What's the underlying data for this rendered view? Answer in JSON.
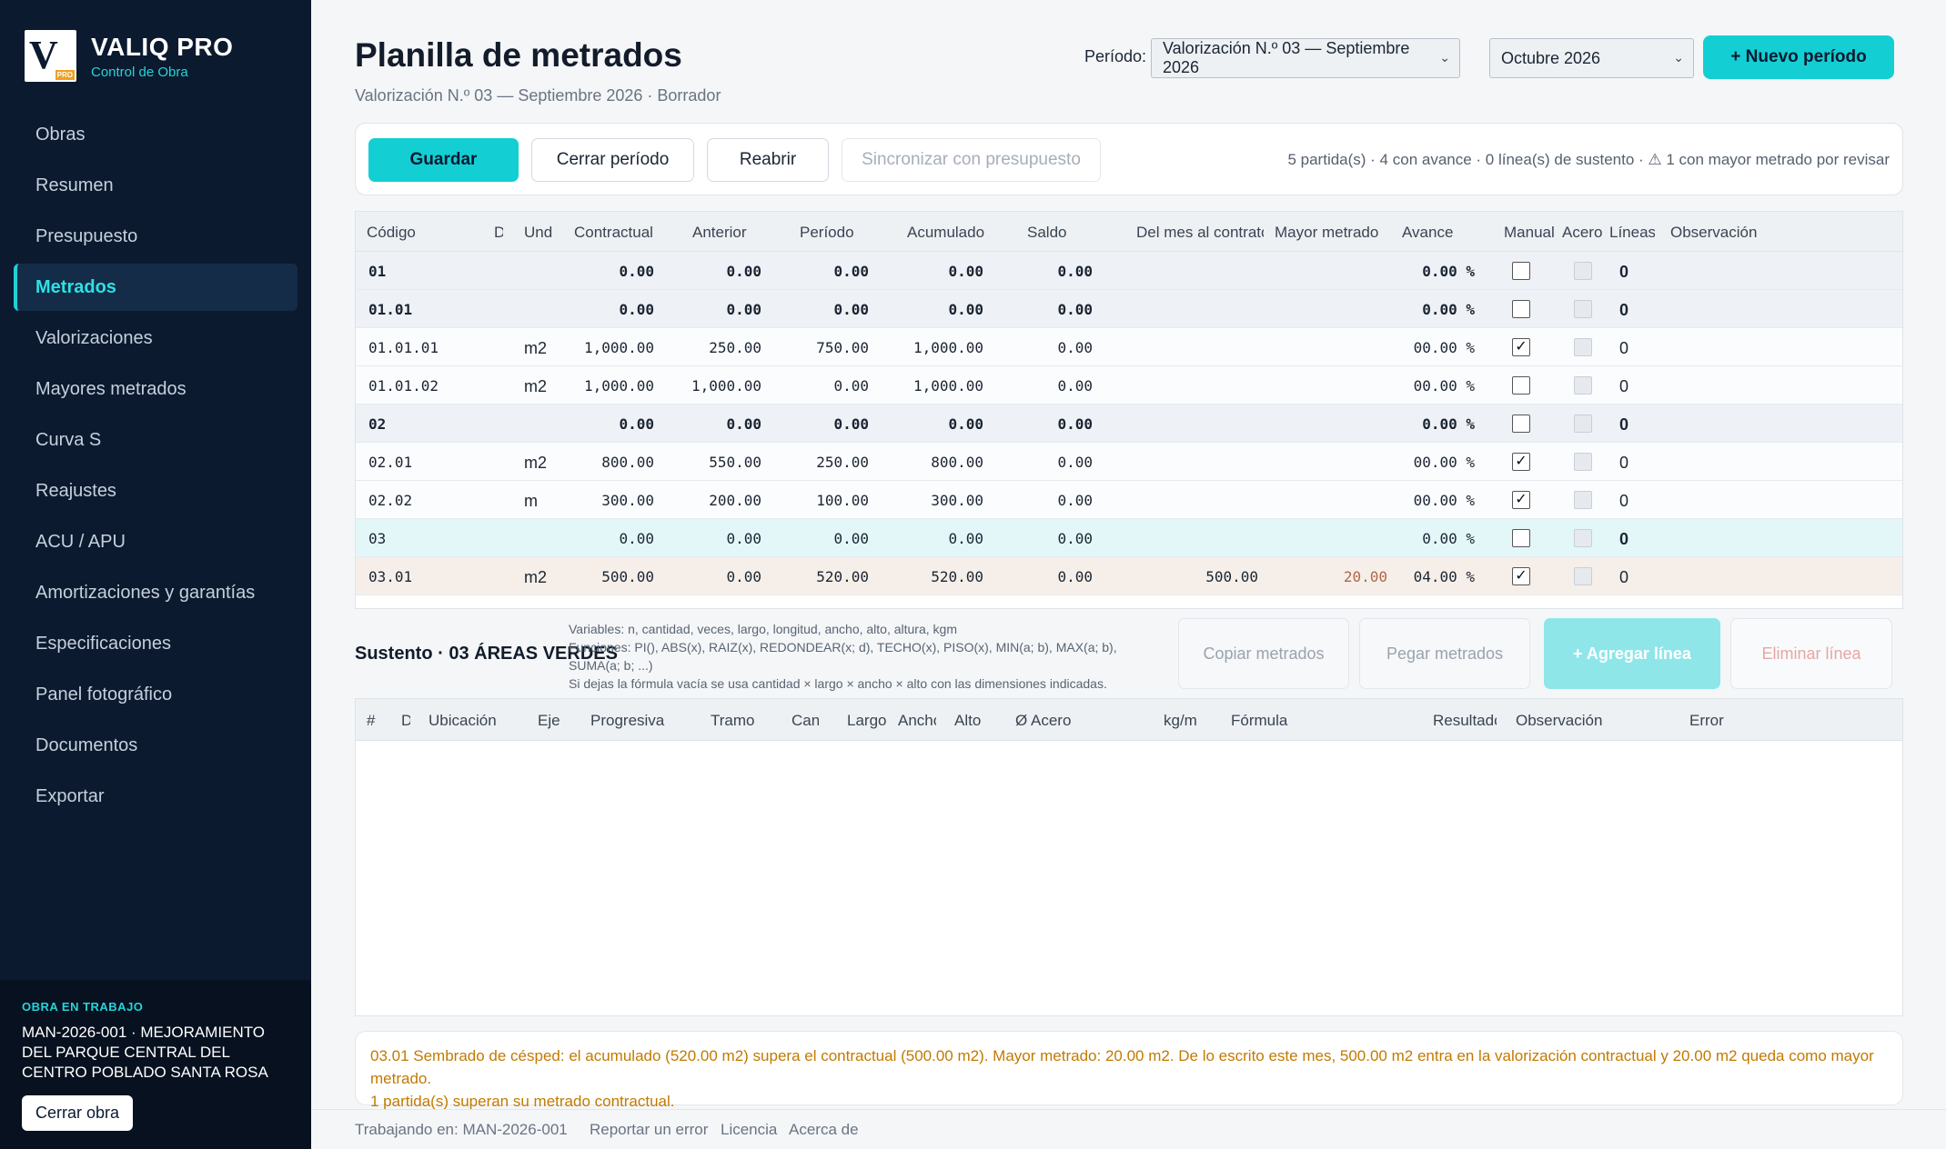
{
  "sidebar": {
    "brand_title": "VALIQ PRO",
    "brand_sub": "Control de Obra",
    "logo_letter": "V",
    "logo_badge": "PRO",
    "items": [
      {
        "label": "Obras"
      },
      {
        "label": "Resumen"
      },
      {
        "label": "Presupuesto"
      },
      {
        "label": "Metrados",
        "active": true
      },
      {
        "label": "Valorizaciones"
      },
      {
        "label": "Mayores metrados"
      },
      {
        "label": "Curva S"
      },
      {
        "label": "Reajustes"
      },
      {
        "label": "ACU / APU"
      },
      {
        "label": "Amortizaciones y garantías"
      },
      {
        "label": "Especificaciones"
      },
      {
        "label": "Panel fotográfico"
      },
      {
        "label": "Documentos"
      },
      {
        "label": "Exportar"
      }
    ],
    "obra_label": "OBRA EN TRABAJO",
    "obra_name": "MAN-2026-001 · MEJORAMIENTO DEL PARQUE CENTRAL DEL CENTRO POBLADO SANTA ROSA",
    "close_obra": "Cerrar obra"
  },
  "header": {
    "title": "Planilla de metrados",
    "subtitle": "Valorización N.º 03 — Septiembre 2026 · Borrador",
    "period_label": "Período:",
    "period_select": "Valorización N.º 03 — Septiembre 2026",
    "month_select": "Octubre 2026",
    "new_period": "+ Nuevo período"
  },
  "toolbar": {
    "save": "Guardar",
    "close_period": "Cerrar período",
    "reopen": "Reabrir",
    "sync": "Sincronizar con presupuesto",
    "status": "5 partida(s) · 4 con avance · 0 línea(s) de sustento · ⚠ 1 con mayor metrado por revisar"
  },
  "table": {
    "headers": [
      "Código",
      "D",
      "Und",
      "Contractual",
      "Anterior",
      "Período",
      "Acumulado",
      "Saldo",
      "Del mes al contrato",
      "Mayor metrado",
      "Avance",
      "Manual",
      "Acero",
      "Líneas",
      "Observación"
    ],
    "rows": [
      {
        "code": "01",
        "und": "",
        "contractual": "0.00",
        "anterior": "0.00",
        "periodo": "0.00",
        "acumulado": "0.00",
        "saldo": "0.00",
        "delmes": "",
        "mayor": "",
        "avance": "0.00 %",
        "manual": false,
        "lineas": "0",
        "kind": "group"
      },
      {
        "code": "01.01",
        "und": "",
        "contractual": "0.00",
        "anterior": "0.00",
        "periodo": "0.00",
        "acumulado": "0.00",
        "saldo": "0.00",
        "delmes": "",
        "mayor": "",
        "avance": "0.00 %",
        "manual": false,
        "lineas": "0",
        "kind": "group"
      },
      {
        "code": "01.01.01",
        "und": "m2",
        "contractual": "1,000.00",
        "anterior": "250.00",
        "periodo": "750.00",
        "acumulado": "1,000.00",
        "saldo": "0.00",
        "delmes": "",
        "mayor": "",
        "avance": "00.00 %",
        "manual": true,
        "lineas": "0",
        "kind": "leaf"
      },
      {
        "code": "01.01.02",
        "und": "m2",
        "contractual": "1,000.00",
        "anterior": "1,000.00",
        "periodo": "0.00",
        "acumulado": "1,000.00",
        "saldo": "0.00",
        "delmes": "",
        "mayor": "",
        "avance": "00.00 %",
        "manual": false,
        "lineas": "0",
        "kind": "leaf"
      },
      {
        "code": "02",
        "und": "",
        "contractual": "0.00",
        "anterior": "0.00",
        "periodo": "0.00",
        "acumulado": "0.00",
        "saldo": "0.00",
        "delmes": "",
        "mayor": "",
        "avance": "0.00 %",
        "manual": false,
        "lineas": "0",
        "kind": "group"
      },
      {
        "code": "02.01",
        "und": "m2",
        "contractual": "800.00",
        "anterior": "550.00",
        "periodo": "250.00",
        "acumulado": "800.00",
        "saldo": "0.00",
        "delmes": "",
        "mayor": "",
        "avance": "00.00 %",
        "manual": true,
        "lineas": "0",
        "kind": "leaf"
      },
      {
        "code": "02.02",
        "und": "m",
        "contractual": "300.00",
        "anterior": "200.00",
        "periodo": "100.00",
        "acumulado": "300.00",
        "saldo": "0.00",
        "delmes": "",
        "mayor": "",
        "avance": "00.00 %",
        "manual": true,
        "lineas": "0",
        "kind": "leaf"
      },
      {
        "code": "03",
        "und": "",
        "contractual": "0.00",
        "anterior": "0.00",
        "periodo": "0.00",
        "acumulado": "0.00",
        "saldo": "0.00",
        "delmes": "",
        "mayor": "",
        "avance": "0.00 %",
        "manual": false,
        "lineas": "0",
        "kind": "hl"
      },
      {
        "code": "03.01",
        "und": "m2",
        "contractual": "500.00",
        "anterior": "0.00",
        "periodo": "520.00",
        "acumulado": "520.00",
        "saldo": "0.00",
        "delmes": "500.00",
        "mayor": "20.00",
        "avance": "04.00 %",
        "manual": true,
        "lineas": "0",
        "kind": "warn"
      }
    ]
  },
  "sustento": {
    "title": "Sustento · 03 ÁREAS VERDES",
    "help_1": "Variables: n, cantidad, veces, largo, longitud, ancho, alto, altura, kgm",
    "help_2": "Funciones: PI(), ABS(x), RAIZ(x), REDONDEAR(x; d), TECHO(x), PISO(x), MIN(a; b), MAX(a; b), SUMA(a; b; ...)",
    "help_3": "Si dejas la fórmula vacía se usa cantidad × largo × ancho × alto con las dimensiones indicadas.",
    "copy": "Copiar metrados",
    "paste": "Pegar metrados",
    "add": "+ Agregar línea",
    "delete": "Eliminar línea",
    "headers": [
      "#",
      "D",
      "Ubicación",
      "Eje",
      "Progresiva",
      "Tramo",
      "Cant",
      "Largo",
      "Ancho",
      "Alto",
      "Ø Acero",
      "kg/m",
      "Fórmula",
      "Resultado",
      "Observación",
      "Error"
    ]
  },
  "alert": {
    "line1": "03.01 Sembrado de césped: el acumulado (520.00 m2) supera el contractual (500.00 m2). Mayor metrado: 20.00 m2. De lo escrito este mes, 500.00 m2 entra en la valorización contractual y 20.00 m2 queda como mayor metrado.",
    "line2": "1 partida(s) superan su metrado contractual."
  },
  "footer": {
    "working": "Trabajando en: MAN-2026-001",
    "report": "Reportar un error",
    "license": "Licencia",
    "about": "Acerca de"
  },
  "colors": {
    "accent": "#13cfd4",
    "sidebar": "#0b1a2f",
    "warning": "#c27a00"
  }
}
